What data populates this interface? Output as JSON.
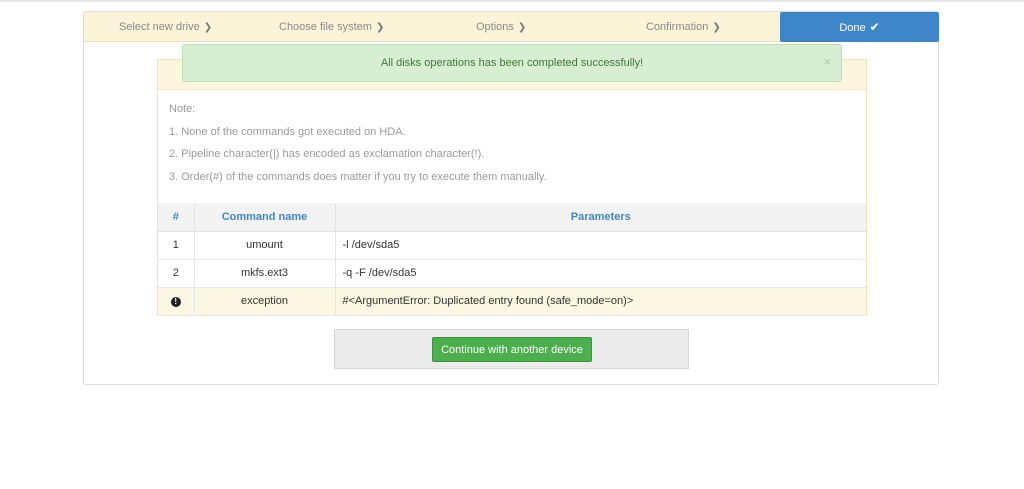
{
  "wizard": {
    "steps": [
      {
        "label": "Select new drive"
      },
      {
        "label": "Choose file system"
      },
      {
        "label": "Options"
      },
      {
        "label": "Confirmation"
      },
      {
        "label": "Done",
        "active": true
      }
    ]
  },
  "alert": {
    "message": "All disks operations has been completed successfully!",
    "close_glyph": "×"
  },
  "notes": [
    "Note:",
    "1. None of the commands got executed on HDA.",
    "2. Pipeline character(|) has encoded as exclamation character(!).",
    "3. Order(#) of the commands does matter if you try to execute them manually."
  ],
  "table": {
    "headers": {
      "num": "#",
      "name": "Command name",
      "params": "Parameters"
    },
    "rows": [
      {
        "num": "1",
        "name": "umount",
        "params": "-l /dev/sda5"
      },
      {
        "num": "2",
        "name": "mkfs.ext3",
        "params": "-q -F /dev/sda5"
      },
      {
        "num": "!",
        "name": "exception",
        "params": "#<ArgumentError: Duplicated entry found (safe_mode=on)>",
        "status": "warning"
      }
    ]
  },
  "footer": {
    "continue_label": "Continue with another device"
  },
  "colors": {
    "accent": "#3f86c8",
    "success_bg": "#d8eed3",
    "success_text": "#3c7a32",
    "button_green": "#4cae4c",
    "warning_row": "#fcf8e3"
  }
}
